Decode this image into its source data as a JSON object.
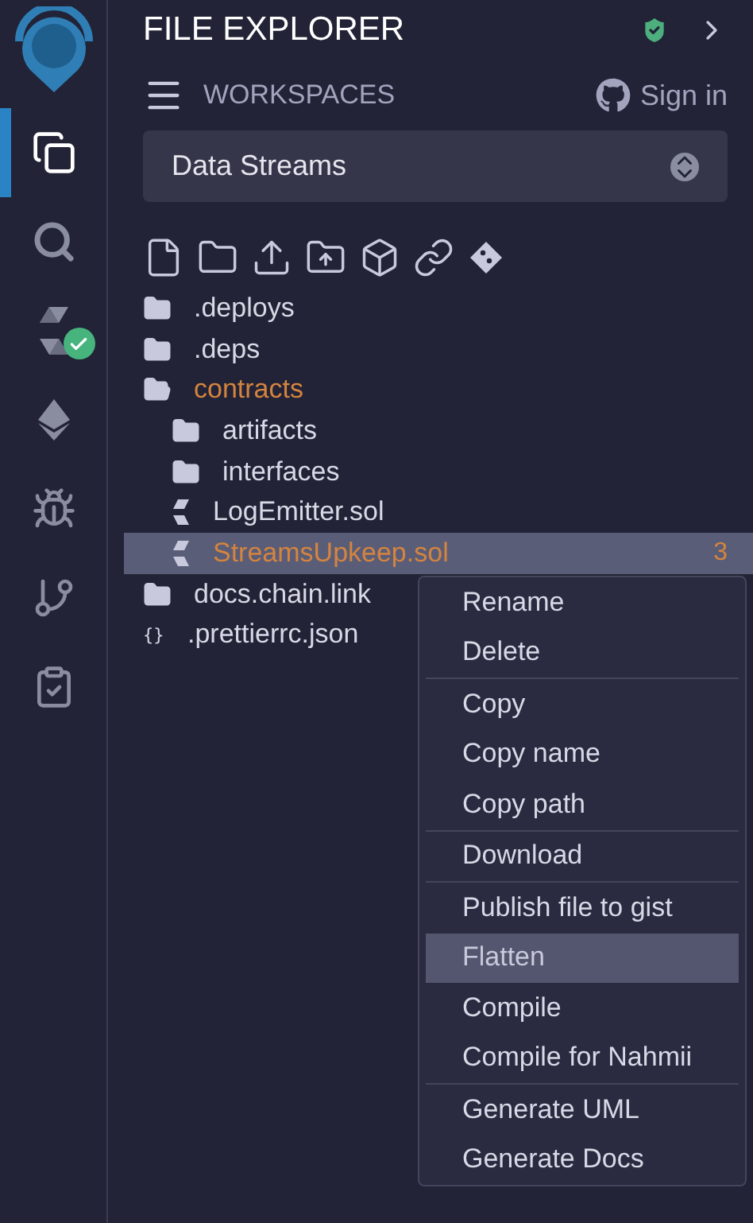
{
  "sidebar": {
    "items": [
      {
        "kind": "files",
        "selected": true,
        "badge": false
      },
      {
        "kind": "search",
        "selected": false,
        "badge": false
      },
      {
        "kind": "compiler",
        "selected": false,
        "badge": true
      },
      {
        "kind": "deploy",
        "selected": false,
        "badge": false
      },
      {
        "kind": "debug",
        "selected": false,
        "badge": false
      },
      {
        "kind": "git",
        "selected": false,
        "badge": false
      },
      {
        "kind": "tests",
        "selected": false,
        "badge": false
      }
    ]
  },
  "panel": {
    "title": "FILE EXPLORER",
    "section": "WORKSPACES",
    "sign_in": "Sign in",
    "workspace": "Data Streams"
  },
  "toolbar": [
    {
      "kind": "new-file"
    },
    {
      "kind": "new-folder"
    },
    {
      "kind": "upload-file"
    },
    {
      "kind": "upload-folder"
    },
    {
      "kind": "ipfs"
    },
    {
      "kind": "link"
    },
    {
      "kind": "git"
    }
  ],
  "tree": [
    {
      "name": ".deploys",
      "kind": "folder",
      "expanded": false,
      "selected": false,
      "warning": false
    },
    {
      "name": ".deps",
      "kind": "folder",
      "expanded": false,
      "selected": false,
      "warning": false
    },
    {
      "name": "contracts",
      "kind": "folder",
      "expanded": true,
      "selected": false,
      "warning": true,
      "children": [
        {
          "name": "artifacts",
          "kind": "folder",
          "expanded": false,
          "selected": false,
          "warning": false
        },
        {
          "name": "interfaces",
          "kind": "folder",
          "expanded": false,
          "selected": false,
          "warning": false
        },
        {
          "name": "LogEmitter.sol",
          "kind": "sol",
          "selected": false,
          "warning": false
        },
        {
          "name": "StreamsUpkeep.sol",
          "kind": "sol",
          "selected": true,
          "warning": true,
          "badge": "3"
        }
      ]
    },
    {
      "name": "docs.chain.link",
      "kind": "folder",
      "expanded": false,
      "selected": false,
      "warning": false
    },
    {
      "name": ".prettierrc.json",
      "kind": "config",
      "icon": "{}",
      "selected": false,
      "warning": false
    }
  ],
  "context_menu": [
    [
      {
        "label": "Rename",
        "selected": false
      },
      {
        "label": "Delete",
        "selected": false
      }
    ],
    [
      {
        "label": "Copy",
        "selected": false
      },
      {
        "label": "Copy name",
        "selected": false
      },
      {
        "label": "Copy path",
        "selected": false
      }
    ],
    [
      {
        "label": "Download",
        "selected": false
      }
    ],
    [
      {
        "label": "Publish file to gist",
        "selected": false
      },
      {
        "label": "Flatten",
        "selected": true
      },
      {
        "label": "Compile",
        "selected": false
      },
      {
        "label": "Compile for Nahmii",
        "selected": false
      }
    ],
    [
      {
        "label": "Generate UML",
        "selected": false
      },
      {
        "label": "Generate Docs",
        "selected": false
      }
    ]
  ]
}
